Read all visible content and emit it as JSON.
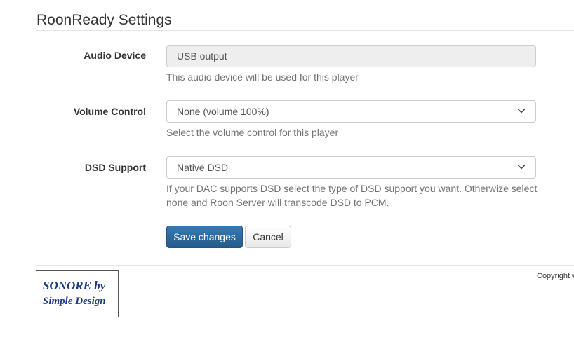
{
  "page": {
    "title": "RoonReady Settings"
  },
  "form": {
    "audio_device": {
      "label": "Audio Device",
      "value": "USB output",
      "help": "This audio device will be used for this player"
    },
    "volume_control": {
      "label": "Volume Control",
      "value": "None (volume 100%)",
      "help": "Select the volume control for this player"
    },
    "dsd_support": {
      "label": "DSD Support",
      "value": "Native DSD",
      "help_line1": "If your DAC supports DSD select the type of DSD support you want. Otherwize select",
      "help_line2": "none and Roon Server will transcode DSD to PCM."
    },
    "buttons": {
      "save_label": "Save changes",
      "cancel_label": "Cancel"
    }
  },
  "footer": {
    "logo_line1": "SONORE by",
    "logo_line2": "Simple Design",
    "copyright": "Copyright ©"
  },
  "icons": {
    "select_arrow": "chevron-down-icon"
  },
  "colors": {
    "primary_button": "#2e6da4",
    "logo_text": "#1f3a8a",
    "readonly_field": "#eeeeee"
  }
}
